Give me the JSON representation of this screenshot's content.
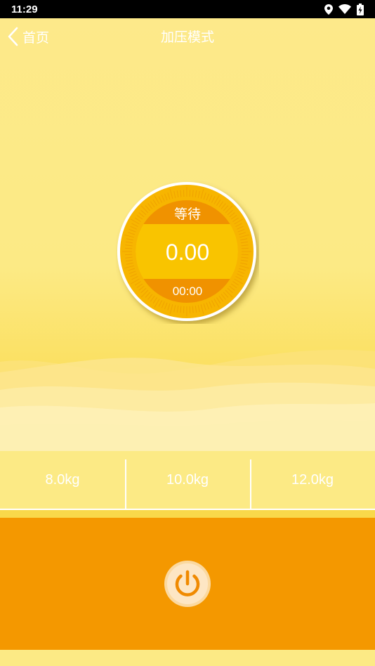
{
  "status_bar": {
    "time": "11:29",
    "icons": [
      "location-icon",
      "wifi-icon",
      "battery-icon"
    ]
  },
  "nav": {
    "back_label": "首页",
    "title": "加压模式"
  },
  "dial": {
    "status": "等待",
    "value": "0.00",
    "timer": "00:00",
    "colors": {
      "outer": "#f7b500",
      "band": "#f09200",
      "center": "#f9c400",
      "ring": "#ffffff"
    }
  },
  "weights": [
    {
      "label": "8.0kg"
    },
    {
      "label": "10.0kg"
    },
    {
      "label": "12.0kg"
    }
  ],
  "power_button": {
    "icon": "power-icon"
  },
  "colors": {
    "accent": "#f49800",
    "background": "#fcea85"
  }
}
